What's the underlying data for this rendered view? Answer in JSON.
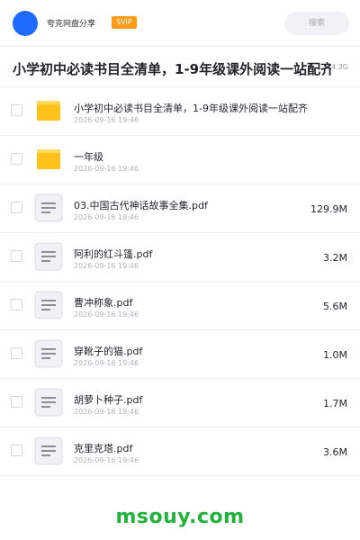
{
  "header": {
    "brand": "夸克网盘分享",
    "badge": "SVIP",
    "search_placeholder": "搜索"
  },
  "share": {
    "title": "小学初中必读书目全清单，1-9年级课外阅读一站配齐",
    "total_size": "4.3G"
  },
  "files": [
    {
      "name": "小学初中必读书目全清单，1-9年级课外阅读一站配齐",
      "date": "2026-09-16 19:46",
      "size": "",
      "type": "folder-icon"
    },
    {
      "name": "一年级",
      "date": "2026-09-16 19:46",
      "size": "",
      "type": "folder-icon"
    },
    {
      "name": "03.中国古代神话故事全集.pdf",
      "date": "2026-09-16 19:46",
      "size": "129.9M",
      "type": "pdf-icon"
    },
    {
      "name": "阿利的红斗篷.pdf",
      "date": "2026-09-16 19:46",
      "size": "3.2M",
      "type": "pdf-icon"
    },
    {
      "name": "曹冲称象.pdf",
      "date": "2026-09-16 19:46",
      "size": "5.6M",
      "type": "pdf-icon"
    },
    {
      "name": "穿靴子的猫.pdf",
      "date": "2026-09-16 19:46",
      "size": "1.0M",
      "type": "pdf-icon"
    },
    {
      "name": "胡萝卜种子.pdf",
      "date": "2026-09-16 19:46",
      "size": "1.7M",
      "type": "pdf-icon"
    },
    {
      "name": "克里克塔.pdf",
      "date": "2026-09-16 19:46",
      "size": "3.6M",
      "type": "pdf-icon"
    }
  ],
  "watermark": "msouy.com",
  "colors": {
    "accent": "#1f6bff",
    "badge": "#ff9b1a",
    "folder": "#ffc21a",
    "watermark": "#20b23b"
  }
}
